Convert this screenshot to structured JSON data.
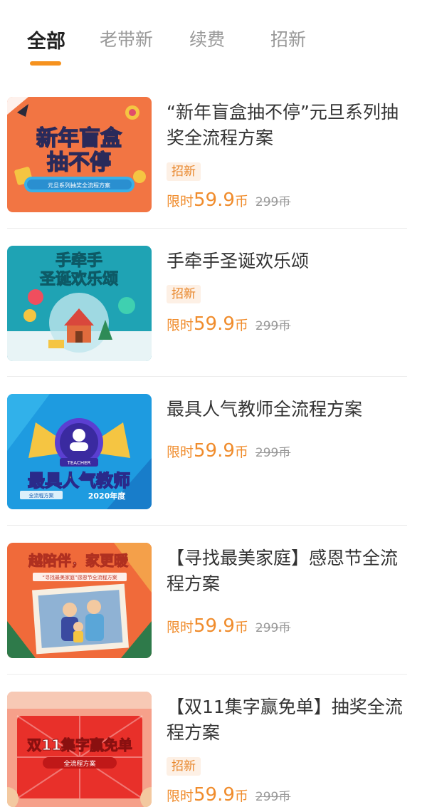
{
  "tabs": [
    {
      "label": "全部",
      "active": true
    },
    {
      "label": "老带新",
      "active": false
    },
    {
      "label": "续费",
      "active": false
    },
    {
      "label": "招新",
      "active": false
    }
  ],
  "accent_color": "#f6921e",
  "price_color": "#f08c2c",
  "items": [
    {
      "title": "“新年盲盒抽不停”元旦系列抽奖全流程方案",
      "tag": "招新",
      "price_prefix": "限时",
      "price": "59.9",
      "price_unit": "币",
      "original_price": "299币",
      "poster": {
        "line1": "新年盲盒",
        "line2": "抽不停",
        "subtitle": "元旦系列抽奖全流程方案"
      }
    },
    {
      "title": "手牵手圣诞欢乐颂",
      "tag": "招新",
      "price_prefix": "限时",
      "price": "59.9",
      "price_unit": "币",
      "original_price": "299币",
      "poster": {
        "line1": "手牵手",
        "line2": "圣诞欢乐颂"
      }
    },
    {
      "title": "最具人气教师全流程方案",
      "tag": "",
      "price_prefix": "限时",
      "price": "59.9",
      "price_unit": "币",
      "original_price": "299币",
      "poster": {
        "line1": "最具人气教师",
        "badge": "TEACHER",
        "ribbon": "全流程方案",
        "year": "2020年度"
      }
    },
    {
      "title": "【寻找最美家庭】感恩节全流程方案",
      "tag": "",
      "price_prefix": "限时",
      "price": "59.9",
      "price_unit": "币",
      "original_price": "299币",
      "poster": {
        "line1": "越陪伴，家更暖",
        "subtitle": "“寻找最美家庭”感恩节全流程方案"
      }
    },
    {
      "title": "【双11集字赢免单】抽奖全流程方案",
      "tag": "招新",
      "price_prefix": "限时",
      "price": "59.9",
      "price_unit": "币",
      "original_price": "299币",
      "poster": {
        "line1": "双11集字赢免单",
        "subtitle": "全流程方案"
      }
    }
  ]
}
